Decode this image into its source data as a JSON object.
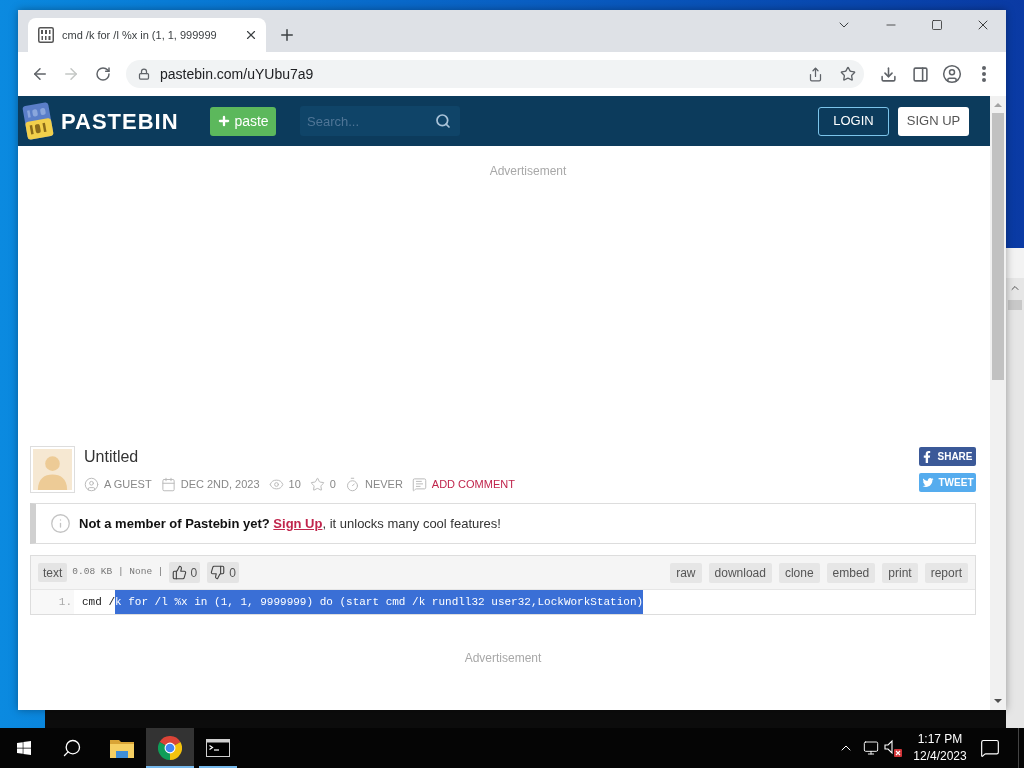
{
  "browser": {
    "tabs": [
      {
        "title": "cmd /k for /l %x in (1, 1, 999999",
        "selected": true
      }
    ],
    "forward_disabled": true,
    "address": "pastebin.com/uYUbu7a9"
  },
  "site": {
    "logo": "PASTEBIN",
    "new_paste_button": "paste",
    "search": {
      "placeholder": "Search..."
    },
    "login_button": "LOGIN",
    "signup_button": "SIGN UP"
  },
  "ad_top": "Advertisement",
  "paste": {
    "title": "Untitled",
    "meta": [
      {
        "kind": "author",
        "text": "A GUEST"
      },
      {
        "kind": "date",
        "text": "DEC 2ND, 2023"
      },
      {
        "kind": "views",
        "text": "10"
      },
      {
        "kind": "favorites",
        "text": "0"
      },
      {
        "kind": "expiry",
        "text": "NEVER"
      },
      {
        "kind": "comment",
        "text": "ADD COMMENT"
      }
    ],
    "share_buttons": [
      {
        "kind": "facebook",
        "label": "SHARE"
      },
      {
        "kind": "twitter",
        "label": "TWEET"
      }
    ],
    "notice": {
      "lead": "Not a member of Pastebin yet?",
      "link": "Sign Up",
      "rest": ", it unlocks many cool features!"
    },
    "toolbar": {
      "syntax": "text",
      "info": "0.08 KB | None |",
      "votes": [
        {
          "kind": "up",
          "count": "0"
        },
        {
          "kind": "down",
          "count": "0"
        }
      ],
      "actions": [
        "raw",
        "download",
        "clone",
        "embed",
        "print",
        "report"
      ]
    },
    "lines": [
      {
        "number": "1.",
        "segments": [
          {
            "text": "cmd /",
            "selected": false
          },
          {
            "text": "k for /l %x in (1, 1, 9999999) do (start cmd /k rundll32 user32,LockWorkStation)",
            "selected": true
          }
        ]
      }
    ]
  },
  "ad_bottom": "Advertisement",
  "taskbar": {
    "apps": [
      {
        "kind": "explorer",
        "selected": false,
        "open": false
      },
      {
        "kind": "chrome",
        "selected": true,
        "open": true
      },
      {
        "kind": "terminal",
        "selected": false,
        "open": true
      }
    ],
    "clock": {
      "time": "1:17 PM",
      "date": "12/4/2023"
    }
  }
}
